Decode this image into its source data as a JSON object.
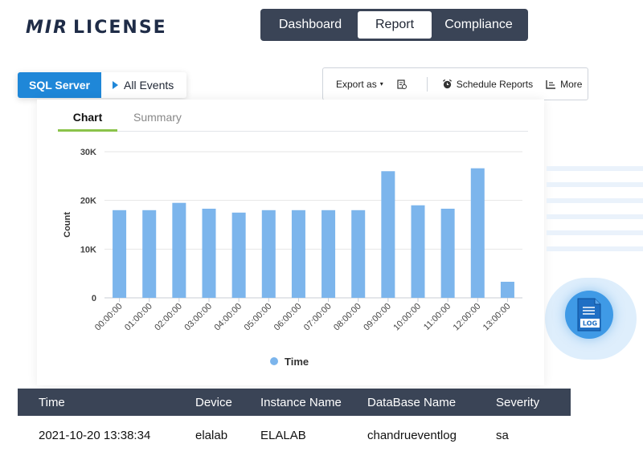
{
  "brand": {
    "mark": "MIR",
    "name": "LICENSE",
    "accent": "#2f7fd8"
  },
  "nav": {
    "tabs": [
      "Dashboard",
      "Report",
      "Compliance"
    ],
    "active": "Report"
  },
  "source": {
    "server": "SQL Server",
    "category": "All Events"
  },
  "toolbar": {
    "export_label": "Export as",
    "schedule_label": "Schedule Reports",
    "more_label": "More",
    "icons": [
      "export-caret-icon",
      "report-file-icon",
      "alarm-clock-icon",
      "more-options-icon"
    ]
  },
  "subtabs": {
    "chart": "Chart",
    "summary": "Summary",
    "active": "Chart"
  },
  "chart_data": {
    "type": "bar",
    "title": "",
    "xlabel": "",
    "ylabel": "Count",
    "ylim": [
      0,
      30000
    ],
    "yticks": [
      0,
      10000,
      20000,
      30000
    ],
    "ytick_labels": [
      "0",
      "10K",
      "20K",
      "30K"
    ],
    "categories": [
      "00:00:00",
      "01:00:00",
      "02:00:00",
      "03:00:00",
      "04:00:00",
      "05:00:00",
      "06:00:00",
      "07:00:00",
      "08:00:00",
      "09:00:00",
      "10:00:00",
      "11:00:00",
      "12:00:00",
      "13:00:00"
    ],
    "series": [
      {
        "name": "Time",
        "color": "#7cb5ec",
        "values": [
          18000,
          18000,
          19500,
          18300,
          17500,
          18000,
          18000,
          18000,
          18000,
          26000,
          19000,
          18300,
          26600,
          3300
        ]
      }
    ],
    "grid": true,
    "legend": "bottom-center"
  },
  "table": {
    "columns": [
      "Time",
      "Device",
      "Instance Name",
      "DataBase Name",
      "Severity"
    ],
    "rows": [
      [
        "2021-10-20 13:38:34",
        "elalab",
        "ELALAB",
        "chandrueventlog",
        "sa"
      ]
    ]
  },
  "log_badge": {
    "label": "LOG",
    "icon": "log-file-icon"
  },
  "colors": {
    "nav_bg": "#3a4456",
    "primary": "#1f87d8",
    "tab_indicator": "#8bc34a"
  }
}
